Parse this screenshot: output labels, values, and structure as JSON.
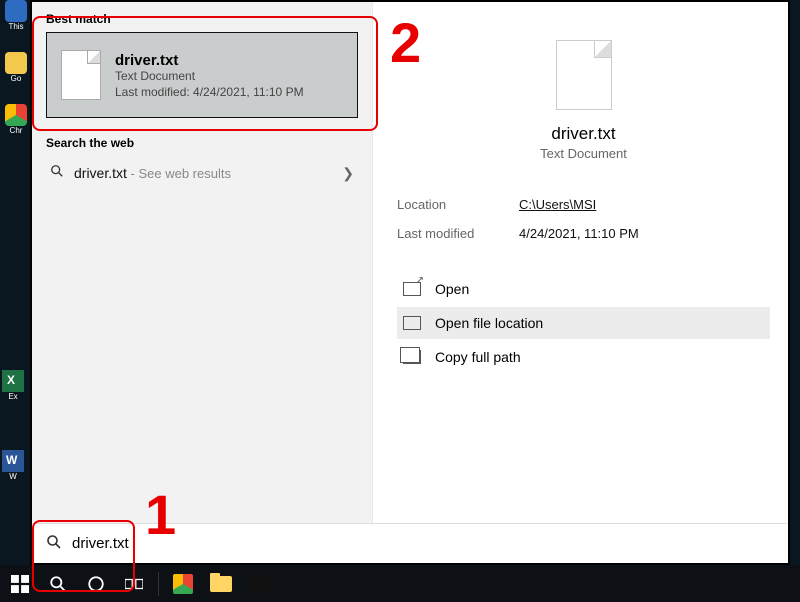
{
  "desktop": {
    "icons": [
      {
        "label": "This",
        "color": "#2d6cc0"
      },
      {
        "label": "Go",
        "color": "#f2c94c"
      },
      {
        "label": "Chr",
        "color": "#e84b3c"
      }
    ],
    "excel_label": "Ex",
    "word_label": "W"
  },
  "search": {
    "best_match_label": "Best match",
    "best_match": {
      "title": "driver.txt",
      "type": "Text Document",
      "modified_label": "Last modified: 4/24/2021, 11:10 PM"
    },
    "web_label": "Search the web",
    "web_row": {
      "term": "driver.txt",
      "hint": " - See web results"
    },
    "input_value": "driver.txt"
  },
  "preview": {
    "name": "driver.txt",
    "type": "Text Document",
    "meta": {
      "location_k": "Location",
      "location_v": "C:\\Users\\MSI",
      "modified_k": "Last modified",
      "modified_v": "4/24/2021, 11:10 PM"
    },
    "actions": {
      "open": "Open",
      "open_location": "Open file location",
      "copy_path": "Copy full path"
    }
  },
  "annotations": {
    "one": "1",
    "two": "2"
  }
}
